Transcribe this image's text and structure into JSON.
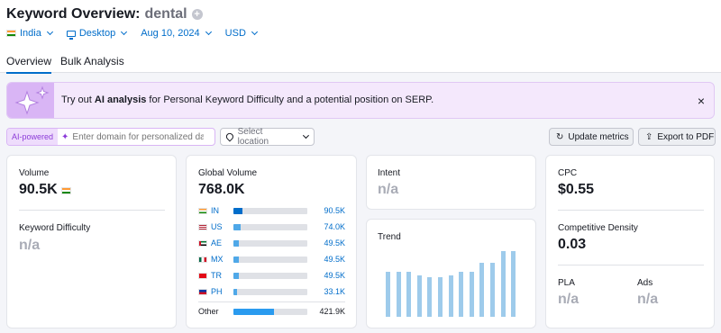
{
  "header": {
    "title": "Keyword Overview:",
    "keyword": "dental",
    "add_icon": "plus-circle-icon"
  },
  "filters": {
    "country": "India",
    "device": "Desktop",
    "date": "Aug 10, 2024",
    "currency": "USD"
  },
  "tabs": [
    {
      "label": "Overview",
      "active": true
    },
    {
      "label": "Bulk Analysis",
      "active": false
    }
  ],
  "banner": {
    "prefix": "Try out ",
    "highlight": "AI analysis",
    "suffix": " for Personal Keyword Difficulty and a potential position on SERP.",
    "close": "×"
  },
  "toolbar": {
    "ai_badge": "AI-powered",
    "domain_placeholder": "Enter domain for personalized data",
    "location_placeholder": "Select location",
    "update_label": "Update metrics",
    "export_label": "Export to PDF"
  },
  "volume_card": {
    "volume_label": "Volume",
    "volume_value": "90.5K",
    "kd_label": "Keyword Difficulty",
    "kd_value": "n/a"
  },
  "global_card": {
    "label": "Global Volume",
    "value": "768.0K",
    "countries": [
      {
        "code": "IN",
        "value": "90.5K",
        "share": 0.12,
        "fill": "#006dca"
      },
      {
        "code": "US",
        "value": "74.0K",
        "share": 0.1,
        "fill": "#4fa8e8"
      },
      {
        "code": "AE",
        "value": "49.5K",
        "share": 0.07,
        "fill": "#4fa8e8"
      },
      {
        "code": "MX",
        "value": "49.5K",
        "share": 0.07,
        "fill": "#4fa8e8"
      },
      {
        "code": "TR",
        "value": "49.5K",
        "share": 0.07,
        "fill": "#4fa8e8"
      },
      {
        "code": "PH",
        "value": "33.1K",
        "share": 0.05,
        "fill": "#4fa8e8"
      }
    ],
    "other": {
      "label": "Other",
      "value": "421.9K",
      "share": 0.55,
      "fill": "#2a9bef"
    }
  },
  "intent_card": {
    "label": "Intent",
    "value": "n/a"
  },
  "trend_card": {
    "label": "Trend"
  },
  "chart_data": {
    "type": "bar",
    "values": [
      0.68,
      0.68,
      0.68,
      0.63,
      0.6,
      0.6,
      0.63,
      0.68,
      0.68,
      0.82,
      0.82,
      1.0,
      1.0
    ],
    "color": "#9ecbeb"
  },
  "cpc_card": {
    "cpc_label": "CPC",
    "cpc_value": "$0.55",
    "density_label": "Competitive Density",
    "density_value": "0.03",
    "pla_label": "PLA",
    "pla_value": "n/a",
    "ads_label": "Ads",
    "ads_value": "n/a"
  }
}
